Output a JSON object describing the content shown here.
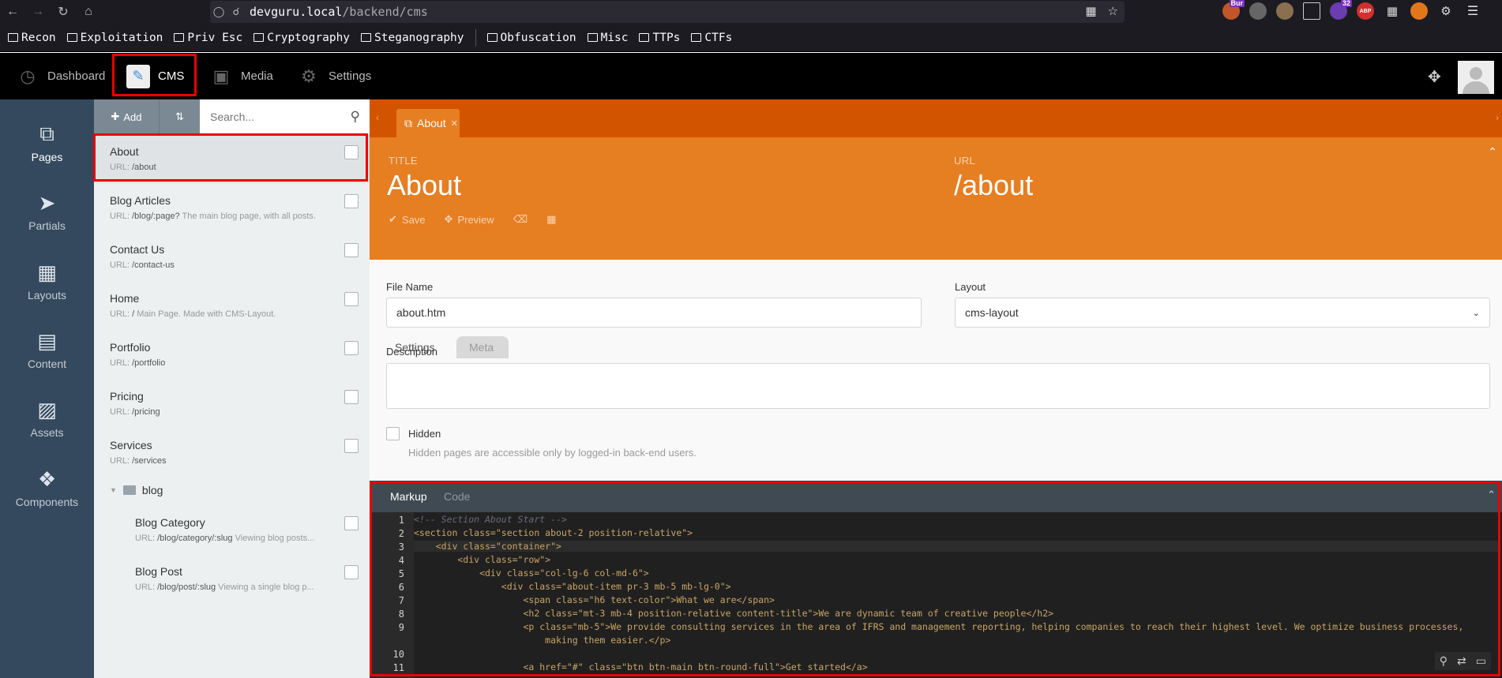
{
  "browser": {
    "url_host": "devguru.local",
    "url_path": "/backend/cms",
    "bookmarks": [
      "Recon",
      "Exploitation",
      "Priv Esc",
      "Cryptography",
      "Steganography",
      "Obfuscation",
      "Misc",
      "TTPs",
      "CTFs"
    ],
    "ext_badge_1": "Bur",
    "ext_badge_2": "32",
    "ext_abp": "ABP"
  },
  "topnav": {
    "items": [
      {
        "label": "Dashboard",
        "icon": "dashboard-gauge-icon"
      },
      {
        "label": "CMS",
        "icon": "cms-icon"
      },
      {
        "label": "Media",
        "icon": "media-icon"
      },
      {
        "label": "Settings",
        "icon": "gear-icon"
      }
    ]
  },
  "sidebar": {
    "items": [
      {
        "label": "Pages",
        "icon": "pages-icon"
      },
      {
        "label": "Partials",
        "icon": "tags-icon"
      },
      {
        "label": "Layouts",
        "icon": "layouts-icon"
      },
      {
        "label": "Content",
        "icon": "file-icon"
      },
      {
        "label": "Assets",
        "icon": "image-icon"
      },
      {
        "label": "Components",
        "icon": "puzzle-icon"
      }
    ]
  },
  "pagelist": {
    "add_label": "Add",
    "search_placeholder": "Search...",
    "url_prefix": "URL: ",
    "items": [
      {
        "title": "About",
        "url": "/about",
        "desc": ""
      },
      {
        "title": "Blog Articles",
        "url": "/blog/:page?",
        "desc": " The main blog page, with all posts."
      },
      {
        "title": "Contact Us",
        "url": "/contact-us",
        "desc": ""
      },
      {
        "title": "Home",
        "url": "/",
        "desc": " Main Page. Made with CMS-Layout."
      },
      {
        "title": "Portfolio",
        "url": "/portfolio",
        "desc": ""
      },
      {
        "title": "Pricing",
        "url": "/pricing",
        "desc": ""
      },
      {
        "title": "Services",
        "url": "/services",
        "desc": ""
      }
    ],
    "folder": "blog",
    "sub_items": [
      {
        "title": "Blog Category",
        "url": "/blog/category/:slug",
        "desc": " Viewing blog posts..."
      },
      {
        "title": "Blog Post",
        "url": "/blog/post/:slug",
        "desc": " Viewing a single blog p..."
      }
    ]
  },
  "editor": {
    "tab_label": "About",
    "title_label": "TITLE",
    "title_value": "About",
    "url_label": "URL",
    "url_value": "/about",
    "actions": {
      "save": "Save",
      "preview": "Preview"
    },
    "form_tabs": [
      "Settings",
      "Meta"
    ],
    "file_name_label": "File Name",
    "file_name_value": "about.htm",
    "layout_label": "Layout",
    "layout_value": "cms-layout",
    "description_label": "Description",
    "hidden_label": "Hidden",
    "hidden_help": "Hidden pages are accessible only by logged-in back-end users."
  },
  "code": {
    "tabs": [
      "Markup",
      "Code"
    ],
    "line_numbers": [
      "1",
      "2",
      "3",
      "4",
      "5",
      "6",
      "7",
      "8",
      "9",
      "",
      "10",
      "11"
    ],
    "lines": [
      "<!-- Section About Start -->",
      "<section class=\"section about-2 position-relative\">",
      "    <div class=\"container\">",
      "        <div class=\"row\">",
      "            <div class=\"col-lg-6 col-md-6\">",
      "                <div class=\"about-item pr-3 mb-5 mb-lg-0\">",
      "                    <span class=\"h6 text-color\">What we are</span>",
      "                    <h2 class=\"mt-3 mb-4 position-relative content-title\">We are dynamic team of creative people</h2>",
      "                    <p class=\"mb-5\">We provide consulting services in the area of IFRS and management reporting, helping companies to reach their highest level. We optimize business processes,",
      "                        making them easier.</p>",
      "",
      "                    <a href=\"#\" class=\"btn btn-main btn-round-full\">Get started</a>"
    ]
  },
  "colors": {
    "accent_orange": "#e67e22",
    "tab_strip": "#d35400",
    "sidebar": "#34495e",
    "highlight_box": "#e00000"
  }
}
